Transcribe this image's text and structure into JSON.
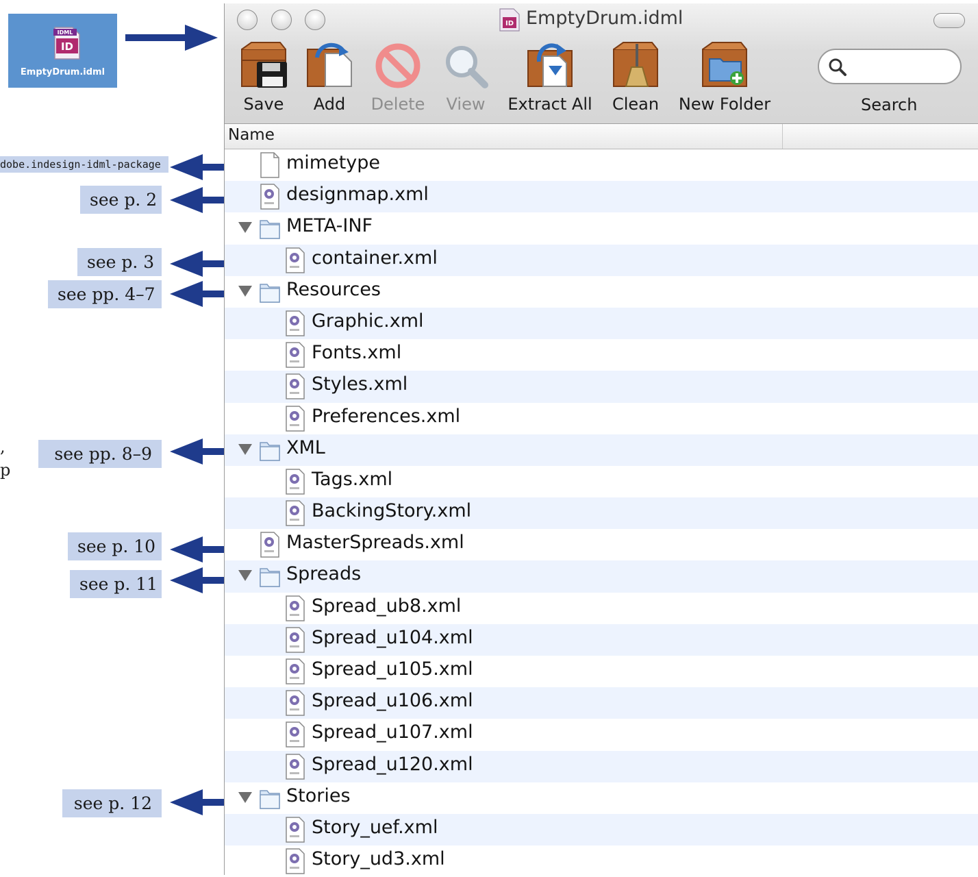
{
  "desktop_icon": {
    "badge": "IDML",
    "glyph": "ID",
    "label": "EmptyDrum.idml"
  },
  "window": {
    "title": "EmptyDrum.idml",
    "title_icon_glyph": "ID"
  },
  "toolbar": [
    {
      "label": "Save",
      "icon": "save-crate-icon",
      "enabled": true
    },
    {
      "label": "Add",
      "icon": "add-crate-icon",
      "enabled": true
    },
    {
      "label": "Delete",
      "icon": "delete-icon",
      "enabled": false
    },
    {
      "label": "View",
      "icon": "magnifier-icon",
      "enabled": false
    },
    {
      "label": "Extract All",
      "icon": "extract-crate-icon",
      "enabled": true
    },
    {
      "label": "Clean",
      "icon": "broom-crate-icon",
      "enabled": true
    },
    {
      "label": "New Folder",
      "icon": "new-folder-crate-icon",
      "enabled": true
    }
  ],
  "search": {
    "label": "Search",
    "value": ""
  },
  "list": {
    "column_header": "Name",
    "items": [
      {
        "name": "mimetype",
        "kind": "file",
        "level": 0
      },
      {
        "name": "designmap.xml",
        "kind": "xml",
        "level": 0
      },
      {
        "name": "META-INF",
        "kind": "folder",
        "level": 0,
        "expanded": true
      },
      {
        "name": "container.xml",
        "kind": "xml",
        "level": 1
      },
      {
        "name": "Resources",
        "kind": "folder",
        "level": 0,
        "expanded": true
      },
      {
        "name": "Graphic.xml",
        "kind": "xml",
        "level": 1
      },
      {
        "name": "Fonts.xml",
        "kind": "xml",
        "level": 1
      },
      {
        "name": "Styles.xml",
        "kind": "xml",
        "level": 1
      },
      {
        "name": "Preferences.xml",
        "kind": "xml",
        "level": 1
      },
      {
        "name": "XML",
        "kind": "folder",
        "level": 0,
        "expanded": true
      },
      {
        "name": "Tags.xml",
        "kind": "xml",
        "level": 1
      },
      {
        "name": "BackingStory.xml",
        "kind": "xml",
        "level": 1
      },
      {
        "name": "MasterSpreads.xml",
        "kind": "xml",
        "level": 0
      },
      {
        "name": "Spreads",
        "kind": "folder",
        "level": 0,
        "expanded": true
      },
      {
        "name": "Spread_ub8.xml",
        "kind": "xml",
        "level": 1
      },
      {
        "name": "Spread_u104.xml",
        "kind": "xml",
        "level": 1
      },
      {
        "name": "Spread_u105.xml",
        "kind": "xml",
        "level": 1
      },
      {
        "name": "Spread_u106.xml",
        "kind": "xml",
        "level": 1
      },
      {
        "name": "Spread_u107.xml",
        "kind": "xml",
        "level": 1
      },
      {
        "name": "Spread_u120.xml",
        "kind": "xml",
        "level": 1
      },
      {
        "name": "Stories",
        "kind": "folder",
        "level": 0,
        "expanded": true
      },
      {
        "name": "Story_uef.xml",
        "kind": "xml",
        "level": 1
      },
      {
        "name": "Story_ud3.xml",
        "kind": "xml",
        "level": 1
      }
    ]
  },
  "annotations": [
    {
      "text": "dobe.indesign-idml-package",
      "style": "mono"
    },
    {
      "text": "see p. 2"
    },
    {
      "text": "see p. 3"
    },
    {
      "text": "see pp. 4–7"
    },
    {
      "text": "see pp. 8–9"
    },
    {
      "text": "see p. 10"
    },
    {
      "text": "see p. 11"
    },
    {
      "text": "see p. 12"
    }
  ],
  "margin_fragments": [
    ",",
    "p"
  ],
  "colors": {
    "arrow": "#1f3b8c",
    "note_bg": "#c6d3ec",
    "row_stripe": "#edf3fe",
    "desktop_icon_bg": "#5b93cf"
  }
}
